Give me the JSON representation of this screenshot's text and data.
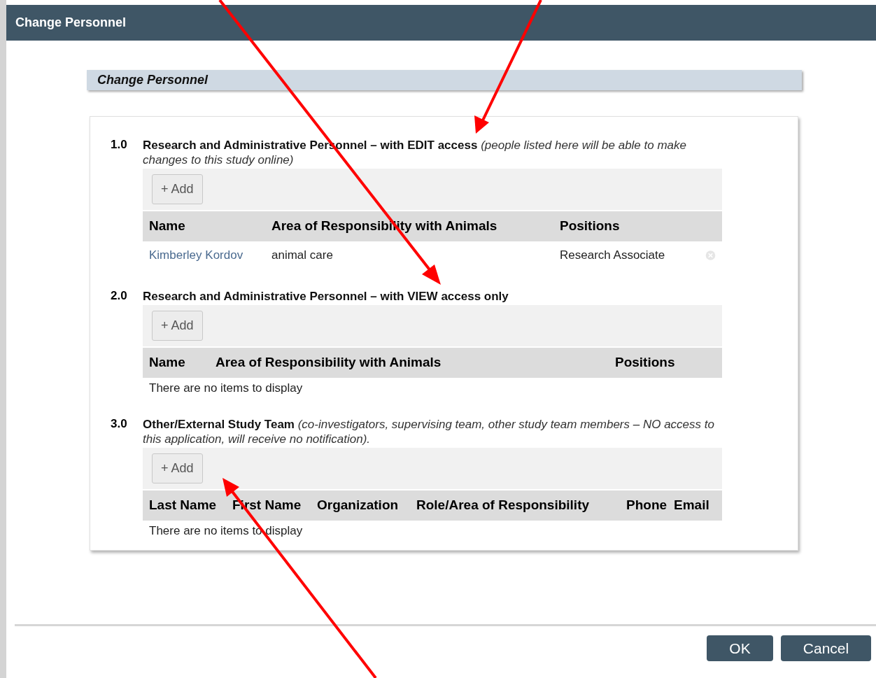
{
  "window": {
    "title": "Change Personnel"
  },
  "panel": {
    "title": "Change Personnel"
  },
  "sections": [
    {
      "number": "1.0",
      "title": "Research and Administrative Personnel – with EDIT access",
      "note": "(people listed here will be able to make changes to this study online)",
      "add_button": "+ Add",
      "columns": [
        "Name",
        "Area of Responsibility with Animals",
        "Positions"
      ],
      "rows": [
        {
          "cells": [
            "Kimberley Kordov",
            "animal care",
            "Research Associate"
          ],
          "removable": true
        }
      ]
    },
    {
      "number": "2.0",
      "title": "Research and Administrative Personnel – with VIEW access only",
      "add_button": "+ Add",
      "columns": [
        "Name",
        "Area of Responsibility with Animals",
        "Positions"
      ],
      "empty_text": "There are no items to display"
    },
    {
      "number": "3.0",
      "title": "Other/External Study Team",
      "note": "(co-investigators, supervising team, other study team members – NO access to this application, will receive no notification).",
      "add_button": "+ Add",
      "columns": [
        "Last Name",
        "First Name",
        "Organization",
        "Role/Area of Responsibility",
        "Phone",
        "Email"
      ],
      "empty_text": "There are no items to display"
    }
  ],
  "buttons": [
    "OK",
    "Cancel"
  ]
}
